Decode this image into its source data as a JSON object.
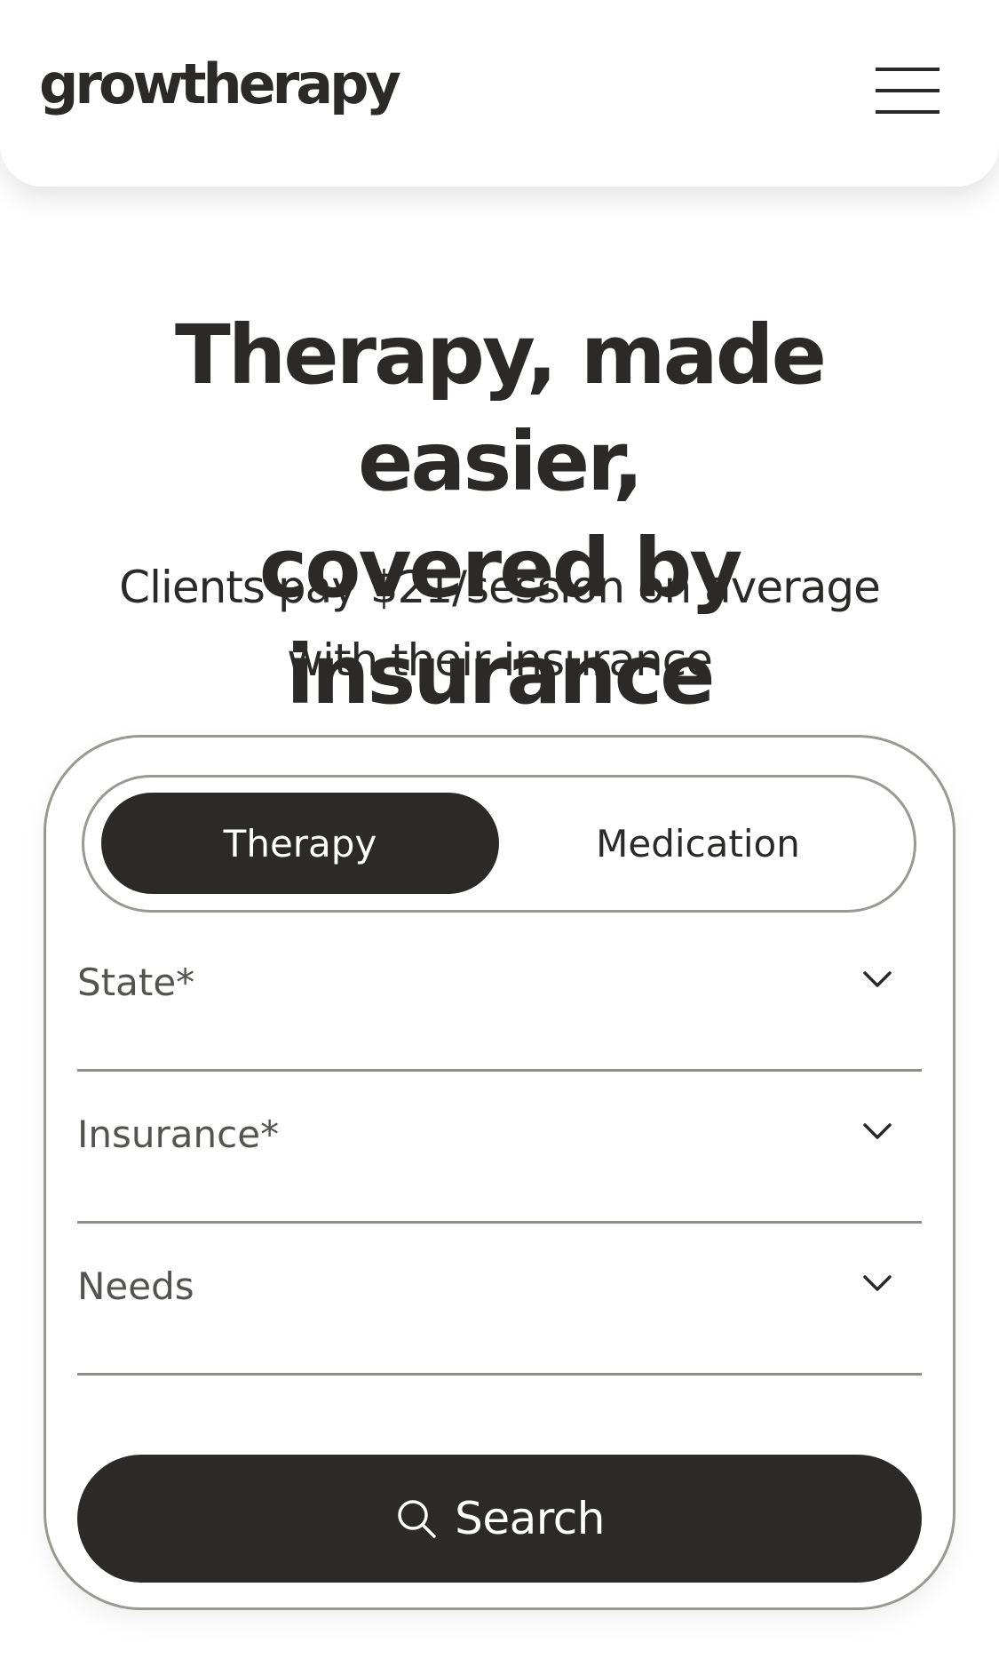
{
  "header": {
    "logo_text": "growtherapy",
    "menu_icon": "hamburger-menu-icon"
  },
  "hero": {
    "title_line1": "Therapy, made easier,",
    "title_line2": "covered by insurance",
    "subtitle_line1": "Clients pay $21/session on average",
    "subtitle_line2": "with their insurance"
  },
  "search": {
    "tabs": [
      {
        "label": "Therapy",
        "selected": true
      },
      {
        "label": "Medication",
        "selected": false
      }
    ],
    "fields": [
      {
        "label": "State*",
        "value": "",
        "icon": "chevron-down-icon"
      },
      {
        "label": "Insurance*",
        "value": "",
        "icon": "chevron-down-icon"
      },
      {
        "label": "Needs",
        "value": "",
        "icon": "chevron-down-icon"
      }
    ],
    "button_label": "Search",
    "button_icon": "search-icon"
  },
  "colors": {
    "primary": "#2b2a29",
    "background": "#ffffff",
    "border": "#9a9893",
    "muted_text": "#555350"
  }
}
